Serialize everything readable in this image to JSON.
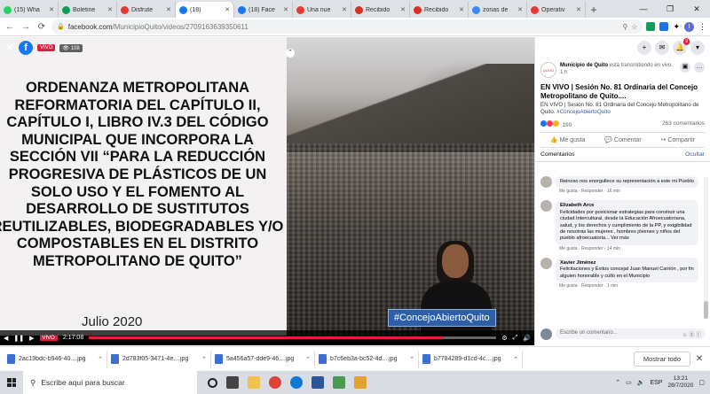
{
  "tabs": [
    {
      "label": "(15) Wha",
      "color": "#25d366"
    },
    {
      "label": "Boletine",
      "color": "#0f9d58"
    },
    {
      "label": "Disfrute",
      "color": "#e53935"
    },
    {
      "label": "(18)",
      "color": "#1877f2"
    },
    {
      "label": "(18) Face",
      "color": "#1877f2"
    },
    {
      "label": "Una nue",
      "color": "#e53935"
    },
    {
      "label": "Recibido",
      "color": "#d93025"
    },
    {
      "label": "Recibido",
      "color": "#d93025"
    },
    {
      "label": "zonas de",
      "color": "#4285f4"
    },
    {
      "label": "Operativ",
      "color": "#e53935"
    }
  ],
  "address": {
    "domain": "facebook.com",
    "path": "/MunicipioQuito/videos/2709163639350611"
  },
  "video": {
    "live_label": "VIVO",
    "viewers": "108",
    "slide_lines": [
      "ORDENANZA METROPOLITANA",
      "REFORMATORIA DEL CAPÍTULO II,",
      "CAPÍTULO I, LIBRO IV.3 DEL CÓDIGO",
      "MUNICIPAL QUE INCORPORA LA",
      "SECCIÓN VII “PARA LA REDUCCIÓN",
      "PROGRESIVA DE PLÁSTICOS DE UN",
      "SOLO USO Y EL FOMENTO AL",
      "DESARROLLO DE SUSTITUTOS",
      "REUTILIZABLES, BIODEGRADABLES Y/O",
      "COMPOSTABLES EN EL DISTRITO",
      "METROPOLITANO DE QUITO”"
    ],
    "slide_date": "Julio 2020",
    "hashtag": "#ConcejoAbiertoQuito",
    "time": "2:17:08",
    "progress": 0.87
  },
  "post": {
    "page_name": "Municipio de Quito",
    "status": "está transmitiendo en vivo.",
    "age": "1 h",
    "title": "EN VIVO | Sesión No. 81 Ordinaria del Concejo Metropolitano de Quito....",
    "desc": "EN VIVO | Sesión No. 81 Ordinaria del Concejo Metropolitano de Quito.",
    "desc_tag": "#ConcejoAbiertoQuito",
    "reaction_count": "190",
    "comment_count": "263 comentarios",
    "like_label": "Me gusta",
    "comment_label": "Comentar",
    "share_label": "Compartir",
    "comments_header": "Comentarios",
    "hide_label": "Ocultar",
    "write_placeholder": "Escribe un comentario..."
  },
  "comments": [
    {
      "name": "",
      "text": "Reinoso nos enorgullece su representación a este mi Pueblo",
      "footer": "Me gusta · Responder · 16 min"
    },
    {
      "name": "Elizabeth Arce",
      "text": "Felicidades por posicionar estrategias para construir una ciudad Intercultural, desde la Educación Afroecuatoriana, salud, y los derechos y cumplimiento de la PP, y exigibilidad de nosotras las mujeres , hombres jóvenes y niños del pueblo afroecuatoria... Ver más",
      "footer": "Me gusta · Responder · 14 min"
    },
    {
      "name": "Xavier Jiménez",
      "text": "Felicitaciones y Éxitos concejal Juan Manuel Carrión , por fin alguien honorable y culto en el Municipio",
      "footer": "Me gusta · Responder · 1 min"
    }
  ],
  "downloads": [
    "2ac19bdc-b946-40....jpg",
    "2d783f05-3471-4e....jpg",
    "5a456a57-dde9-46....jpg",
    "b7c6eb3a-bc52-4d....jpg",
    "b7784289-d1cd-4c....jpg"
  ],
  "show_all_label": "Mostrar todo",
  "taskbar": {
    "search_placeholder": "Escribe aquí para buscar",
    "lang": "ESP",
    "time": "13:21",
    "date": "28/7/2020"
  }
}
